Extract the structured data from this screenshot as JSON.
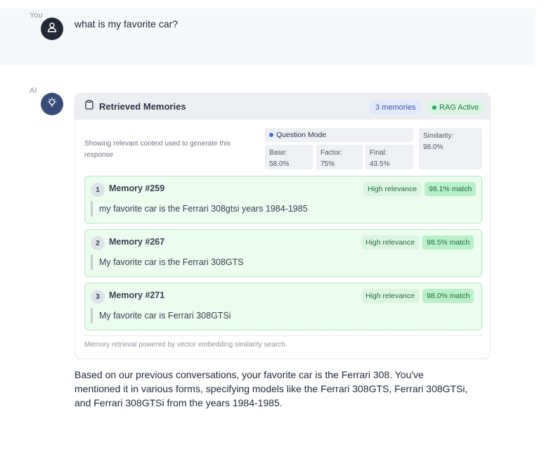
{
  "user": {
    "role": "You",
    "message": "what is my favorite car?"
  },
  "ai": {
    "role": "AI"
  },
  "memories_card": {
    "title": "Retrieved Memories",
    "count_badge": "3 memories",
    "status_badge": "RAG Active",
    "description": "Showing relevant context used to generate this response",
    "mode": "Question Mode",
    "metrics": {
      "base_label": "Base:",
      "base_value": "58.0%",
      "factor_label": "Factor:",
      "factor_value": "75%",
      "final_label": "Final:",
      "final_value": "43.5%",
      "similarity_label": "Similarity:",
      "similarity_value": "98.0%"
    },
    "items": [
      {
        "num": "1",
        "title": "Memory #259",
        "relevance": "High relevance",
        "match": "98.1% match",
        "text": "my favorite car is the Ferrari 308gtsi years 1984-1985"
      },
      {
        "num": "2",
        "title": "Memory #267",
        "relevance": "High relevance",
        "match": "98.5% match",
        "text": "My favorite car is the Ferrari 308GTS"
      },
      {
        "num": "3",
        "title": "Memory #271",
        "relevance": "High relevance",
        "match": "98.0% match",
        "text": "My favorite car is Ferrari 308GTSi"
      }
    ],
    "footer": "Memory retrieval powered by vector embedding similarity search."
  },
  "answer": "Based on our previous conversations, your favorite car is the Ferrari 308. You've mentioned it in various forms, specifying models like the Ferrari 308GTS, Ferrari 308GTSi, and Ferrari 308GTSi from the years 1984-1985.",
  "colors": {
    "accent_blue": "#3a5aa8",
    "accent_green": "#237a43",
    "memory_bg": "#ecfcef"
  }
}
